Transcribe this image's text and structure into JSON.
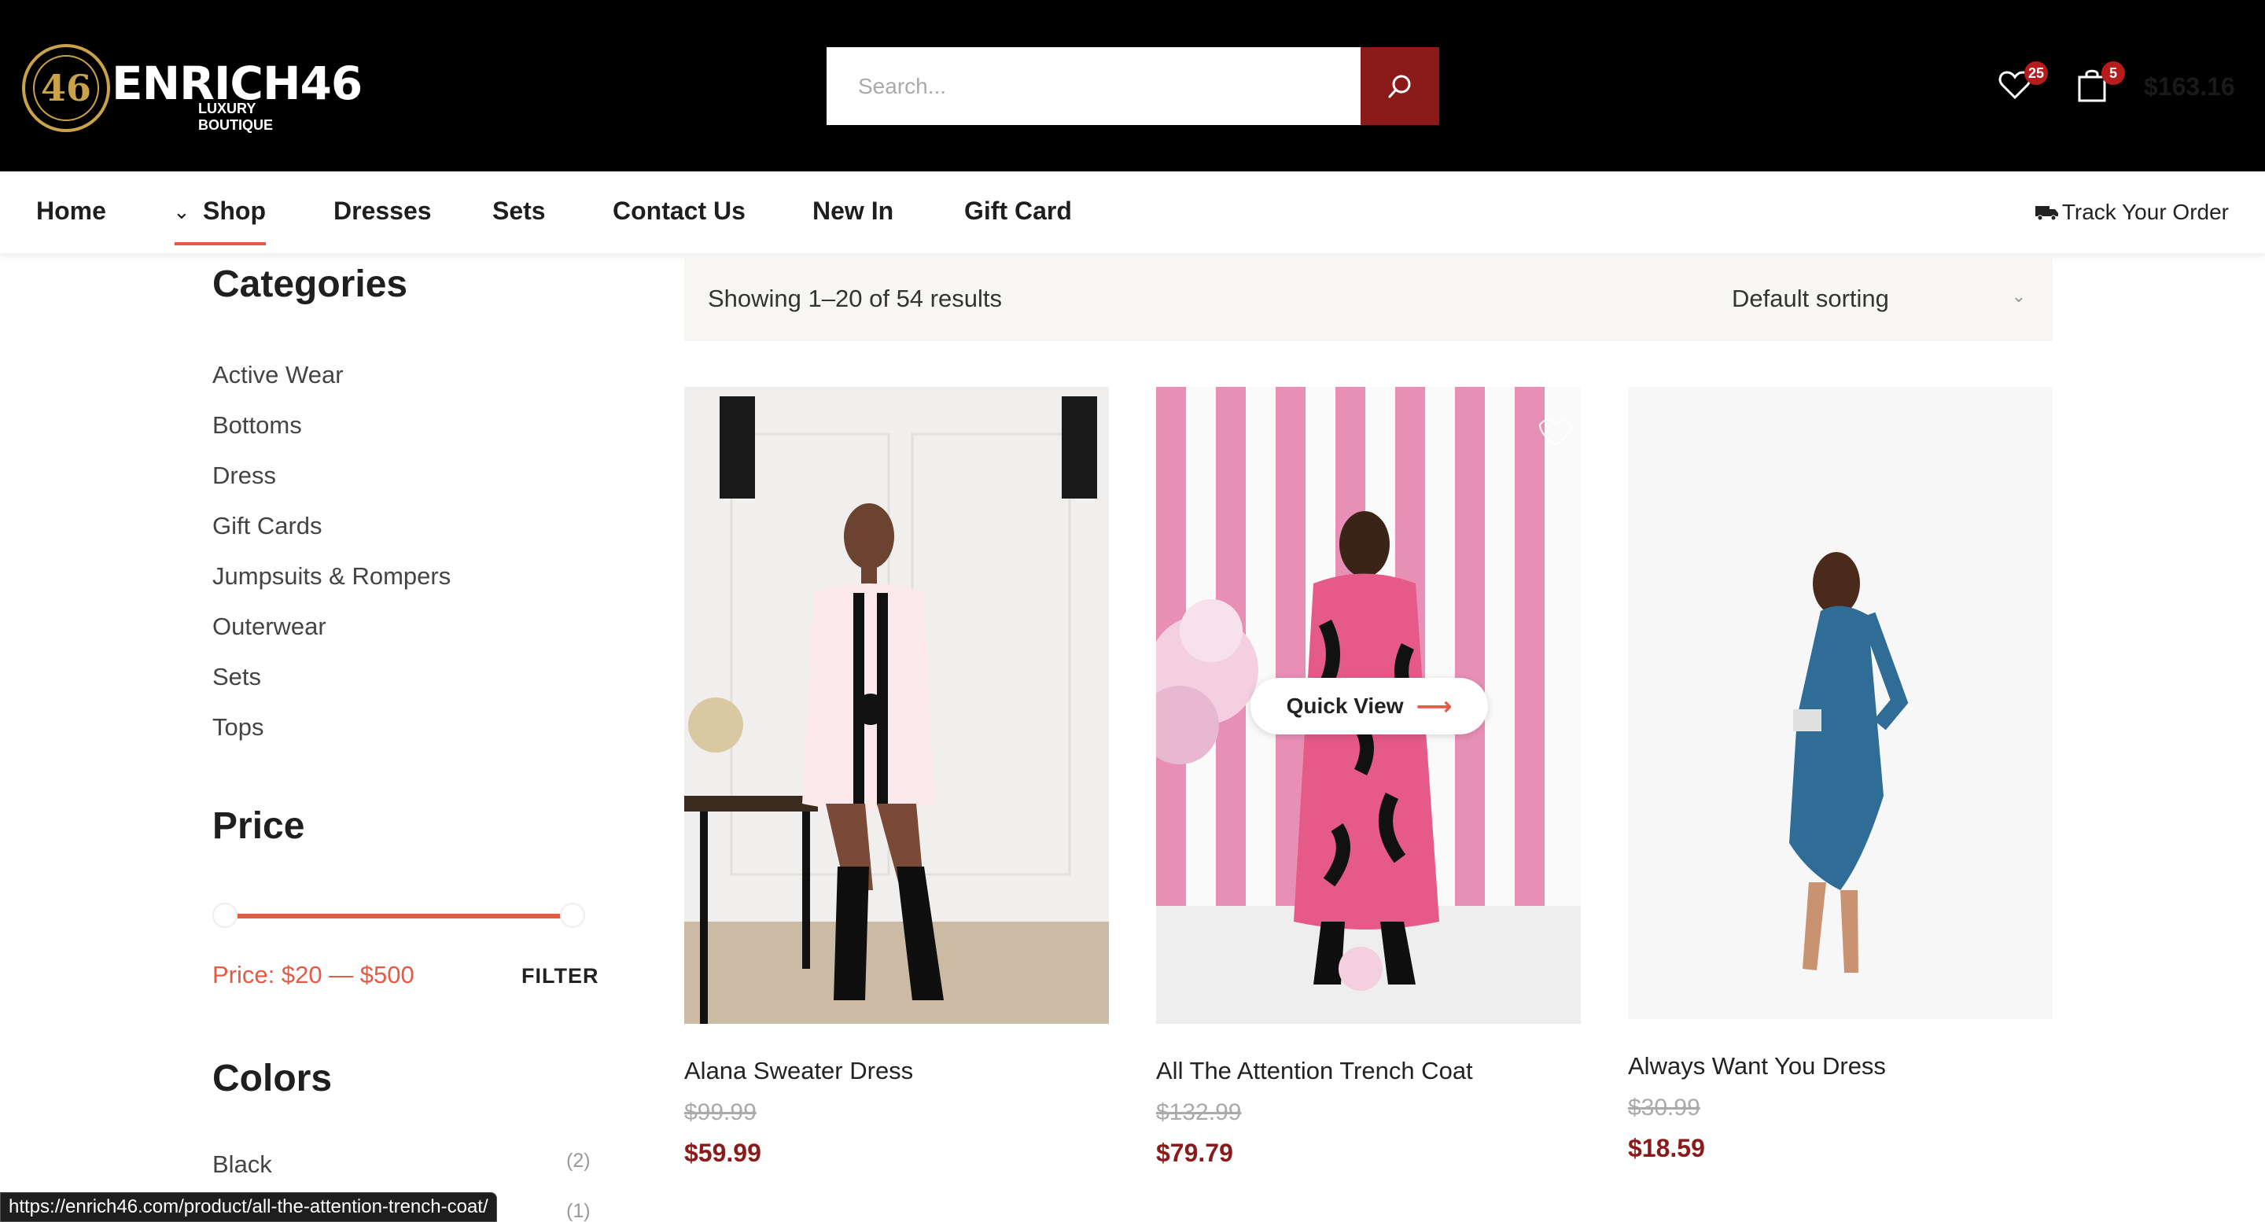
{
  "header": {
    "logo": {
      "mark": "46",
      "brand": "ENRICH46",
      "tagline": "LUXURY BOUTIQUE"
    },
    "search": {
      "placeholder": "Search..."
    },
    "wishlist_count": "25",
    "cart_count": "5",
    "cart_total": "$163.16"
  },
  "nav": {
    "items": [
      {
        "label": "Home"
      },
      {
        "label": "Shop"
      },
      {
        "label": "Dresses"
      },
      {
        "label": "Sets"
      },
      {
        "label": "Contact Us"
      },
      {
        "label": "New In"
      },
      {
        "label": "Gift Card"
      }
    ],
    "track_order": "Track Your Order"
  },
  "sidebar": {
    "categories_title": "Categories",
    "categories": [
      {
        "label": "Active Wear"
      },
      {
        "label": "Bottoms"
      },
      {
        "label": "Dress"
      },
      {
        "label": "Gift Cards"
      },
      {
        "label": "Jumpsuits & Rompers"
      },
      {
        "label": "Outerwear"
      },
      {
        "label": "Sets"
      },
      {
        "label": "Tops"
      }
    ],
    "price_title": "Price",
    "price_label": "Price: $20 — $500",
    "filter_label": "FILTER",
    "colors_title": "Colors",
    "colors": [
      {
        "label": "Black",
        "count": "(2)"
      },
      {
        "label": "",
        "count": "(1)"
      }
    ]
  },
  "toolbar": {
    "result_count": "Showing 1–20 of 54 results",
    "sorting": "Default sorting"
  },
  "products": [
    {
      "title": "Alana Sweater Dress",
      "old_price": "$99.99",
      "new_price": "$59.99"
    },
    {
      "title": "All The Attention Trench Coat",
      "old_price": "$132.99",
      "new_price": "$79.79",
      "quick_view": "Quick View"
    },
    {
      "title": "Always Want You Dress",
      "old_price": "$30.99",
      "new_price": "$18.59"
    }
  ],
  "status_url": "https://enrich46.com/product/all-the-attention-trench-coat/",
  "colors": {
    "accent": "#e55a44",
    "brand_red": "#8b1a1a",
    "toolbar_bg": "#f7f6f2"
  }
}
